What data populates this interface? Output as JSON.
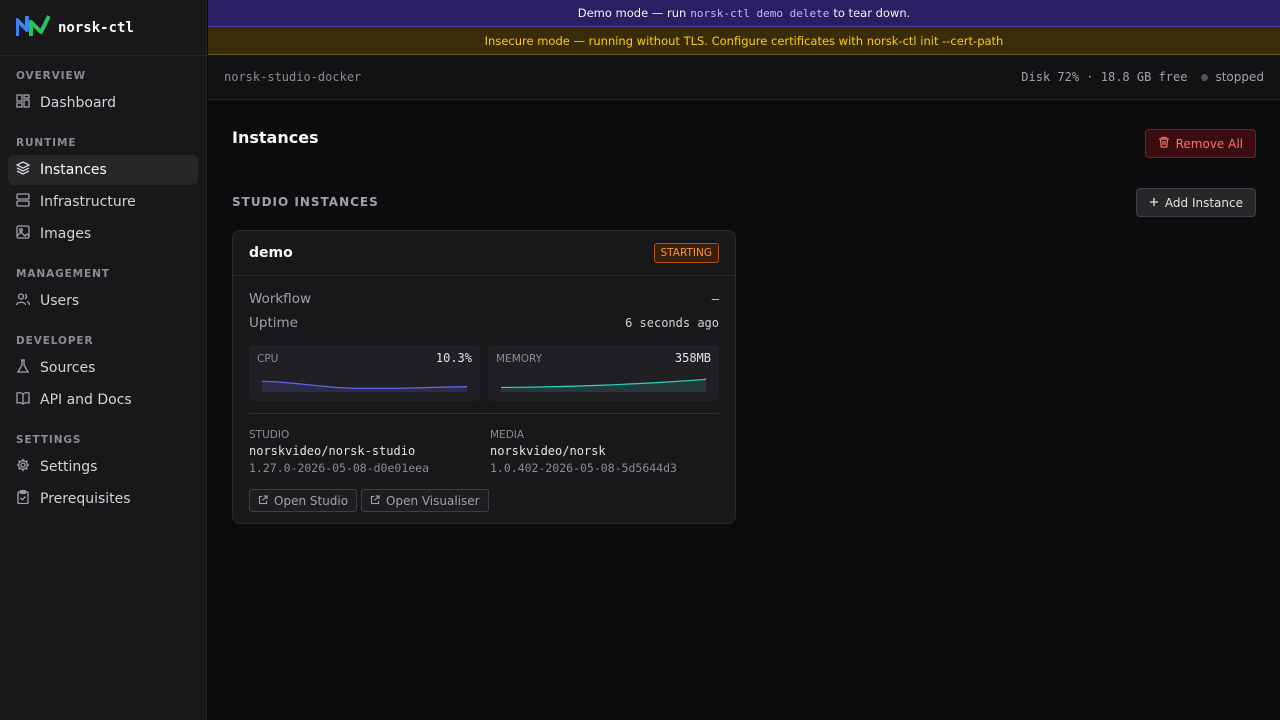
{
  "app": {
    "name": "norsk-ctl",
    "logo_icon": "norsk-logo-icon"
  },
  "sidebar": {
    "sections": [
      {
        "label": "OVERVIEW",
        "items": [
          {
            "label": "Dashboard",
            "icon": "dashboard-icon"
          }
        ]
      },
      {
        "label": "RUNTIME",
        "items": [
          {
            "label": "Instances",
            "icon": "layers-icon",
            "active": true
          },
          {
            "label": "Infrastructure",
            "icon": "server-icon"
          },
          {
            "label": "Images",
            "icon": "image-icon"
          }
        ]
      },
      {
        "label": "MANAGEMENT",
        "items": [
          {
            "label": "Users",
            "icon": "users-icon"
          }
        ]
      },
      {
        "label": "DEVELOPER",
        "items": [
          {
            "label": "Sources",
            "icon": "flask-icon"
          },
          {
            "label": "API and Docs",
            "icon": "book-icon"
          }
        ]
      },
      {
        "label": "SETTINGS",
        "items": [
          {
            "label": "Settings",
            "icon": "gear-icon"
          },
          {
            "label": "Prerequisites",
            "icon": "clipboard-icon"
          }
        ]
      }
    ]
  },
  "banners": {
    "demo": {
      "prefix": "Demo mode — run",
      "command": "norsk-ctl demo delete",
      "suffix": "to tear down."
    },
    "insecure": "Insecure mode — running without TLS. Configure certificates with norsk-ctl init --cert-path"
  },
  "header": {
    "host": "norsk-studio-docker",
    "disk": "Disk 72% · 18.8 GB free",
    "status": "stopped"
  },
  "main": {
    "title": "Instances",
    "remove_all": "Remove All",
    "section_title": "STUDIO INSTANCES",
    "add_instance": "Add Instance"
  },
  "instance": {
    "name": "demo",
    "state": "STARTING",
    "workflow_label": "Workflow",
    "workflow_value": "–",
    "uptime_label": "Uptime",
    "uptime_value": "6 seconds ago",
    "cpu": {
      "label": "CPU",
      "value": "10.3%",
      "series": [
        0.6,
        0.55,
        0.45,
        0.35,
        0.25,
        0.2,
        0.2,
        0.2,
        0.22,
        0.25,
        0.28,
        0.3
      ]
    },
    "memory": {
      "label": "MEMORY",
      "value": "358MB",
      "series": [
        0.25,
        0.26,
        0.28,
        0.3,
        0.33,
        0.36,
        0.4,
        0.45,
        0.5,
        0.56,
        0.63,
        0.7
      ]
    },
    "studio": {
      "label": "STUDIO",
      "image": "norskvideo/norsk-studio",
      "tag": "1.27.0-2026-05-08-d0e01eea"
    },
    "media": {
      "label": "MEDIA",
      "image": "norskvideo/norsk",
      "tag": "1.0.402-2026-05-08-5d5644d3"
    },
    "open_studio": "Open Studio",
    "open_visualiser": "Open Visualiser"
  },
  "colors": {
    "cpu_line": "#6366f1",
    "memory_line": "#2dd4bf",
    "danger": "#f87171",
    "warning": "#facc15"
  }
}
